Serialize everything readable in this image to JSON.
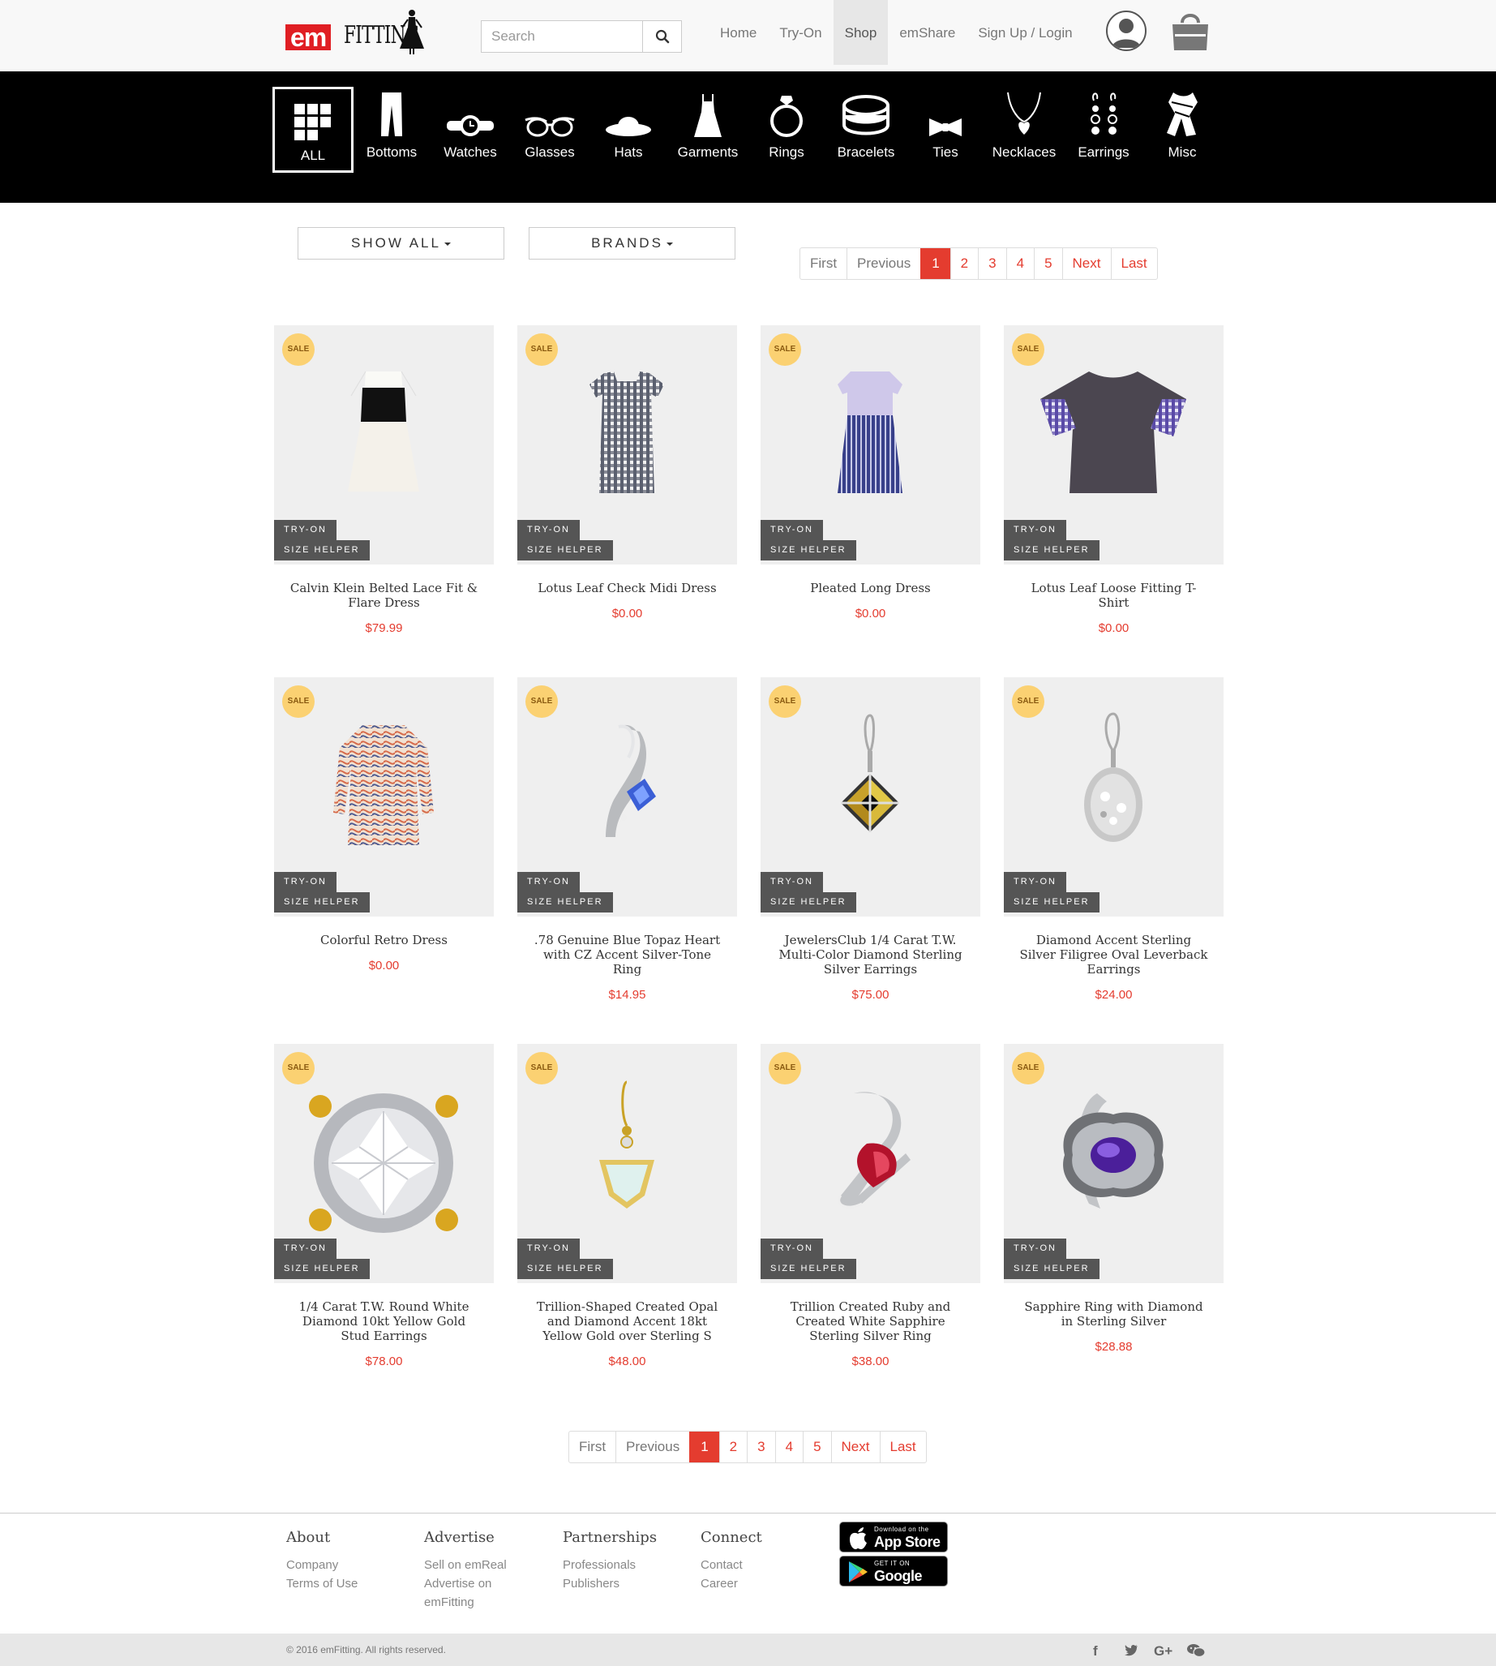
{
  "header": {
    "logo_em": "em",
    "logo_fitting": "FITTING",
    "search_placeholder": "Search",
    "nav": [
      "Home",
      "Try-On",
      "Shop",
      "emShare",
      "Sign Up / Login"
    ],
    "active_nav": "Shop"
  },
  "categories": [
    {
      "label": "ALL",
      "icon": "grid-icon",
      "active": true
    },
    {
      "label": "Bottoms",
      "icon": "pants-icon"
    },
    {
      "label": "Watches",
      "icon": "watch-icon"
    },
    {
      "label": "Glasses",
      "icon": "glasses-icon"
    },
    {
      "label": "Hats",
      "icon": "hat-icon"
    },
    {
      "label": "Garments",
      "icon": "dress-icon"
    },
    {
      "label": "Rings",
      "icon": "ring-icon"
    },
    {
      "label": "Bracelets",
      "icon": "bracelet-icon"
    },
    {
      "label": "Ties",
      "icon": "bowtie-icon"
    },
    {
      "label": "Necklaces",
      "icon": "necklace-icon"
    },
    {
      "label": "Earrings",
      "icon": "earrings-icon"
    },
    {
      "label": "Misc",
      "icon": "scarf-icon"
    }
  ],
  "filters": {
    "show_all": "SHOW ALL",
    "brands": "BRANDS"
  },
  "pagination": {
    "first": "First",
    "previous": "Previous",
    "pages": [
      "1",
      "2",
      "3",
      "4",
      "5"
    ],
    "current": "1",
    "next": "Next",
    "last": "Last"
  },
  "product_badges": {
    "sale": "SALE",
    "try_on": "TRY-ON",
    "size_helper": "SIZE HELPER"
  },
  "products": [
    {
      "name": "Calvin Klein Belted Lace Fit & Flare Dress",
      "price": "$79.99",
      "art": "dress-lace"
    },
    {
      "name": "Lotus Leaf Check Midi Dress",
      "price": "$0.00",
      "art": "dress-check"
    },
    {
      "name": "Pleated Long Dress",
      "price": "$0.00",
      "art": "dress-pleated"
    },
    {
      "name": "Lotus Leaf Loose Fitting T-Shirt",
      "price": "$0.00",
      "art": "tshirt"
    },
    {
      "name": "Colorful Retro Dress",
      "price": "$0.00",
      "art": "dress-retro"
    },
    {
      "name": ".78 Genuine Blue Topaz Heart with CZ Accent Silver-Tone Ring",
      "price": "$14.95",
      "art": "ring-topaz"
    },
    {
      "name": "JewelersClub 1/4 Carat T.W. Multi-Color Diamond Sterling Silver Earrings",
      "price": "$75.00",
      "art": "earring-multi"
    },
    {
      "name": "Diamond Accent Sterling Silver Filigree Oval Leverback Earrings",
      "price": "$24.00",
      "art": "earring-oval"
    },
    {
      "name": "1/4 Carat T.W. Round White Diamond 10kt Yellow Gold Stud Earrings",
      "price": "$78.00",
      "art": "stud"
    },
    {
      "name": "Trillion-Shaped Created Opal and Diamond Accent 18kt Yellow Gold over Sterling S",
      "price": "$48.00",
      "art": "earring-opal"
    },
    {
      "name": "Trillion Created Ruby and Created White Sapphire Sterling Silver Ring",
      "price": "$38.00",
      "art": "ring-ruby"
    },
    {
      "name": "Sapphire Ring with Diamond in Sterling Silver",
      "price": "$28.88",
      "art": "ring-sapphire"
    }
  ],
  "footer": {
    "columns": [
      {
        "title": "About",
        "links": [
          "Company",
          "Terms of Use"
        ]
      },
      {
        "title": "Advertise",
        "links": [
          "Sell on emReal",
          "Advertise on emFitting"
        ]
      },
      {
        "title": "Partnerships",
        "links": [
          "Professionals",
          "Publishers"
        ]
      },
      {
        "title": "Connect",
        "links": [
          "Contact",
          "Career"
        ]
      }
    ],
    "app_store": {
      "small": "Download on the",
      "big": "App Store"
    },
    "google_play": {
      "small": "GET IT ON",
      "big": "Google Play"
    },
    "copyright": "© 2016 emFitting. All rights reserved.",
    "social": [
      "facebook-icon",
      "twitter-icon",
      "google-plus-icon",
      "wechat-icon"
    ]
  },
  "colors": {
    "accent": "#e43c2f",
    "sale_badge": "#fbd172",
    "category_bar": "#000000",
    "tag_bg": "#555555"
  }
}
